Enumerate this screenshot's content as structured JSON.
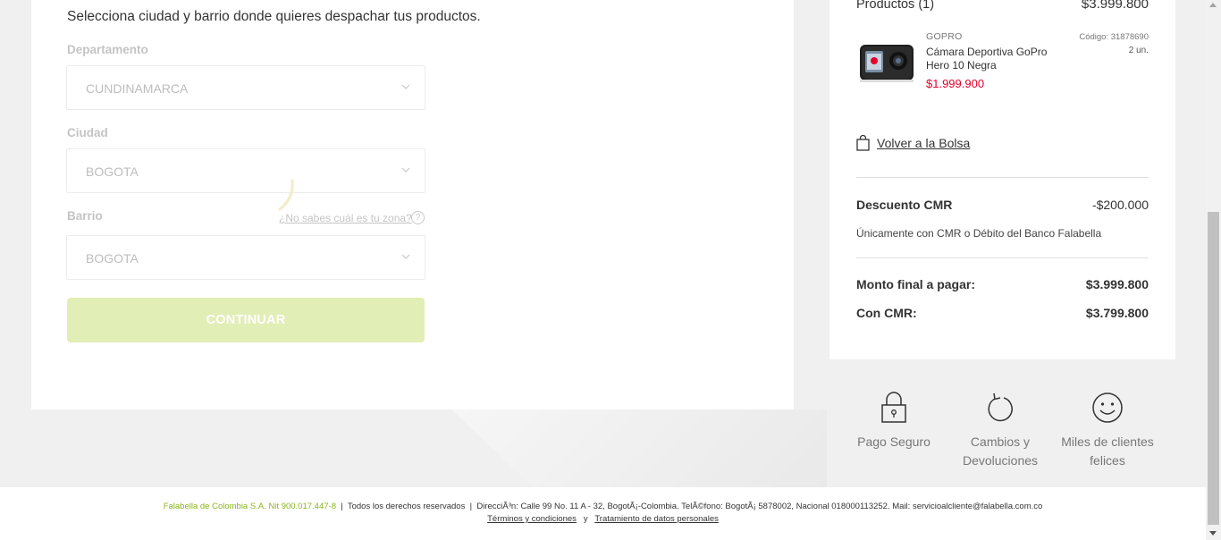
{
  "form": {
    "intro": "Selecciona ciudad y barrio donde quieres despachar tus productos.",
    "department_label": "Departamento",
    "department_value": "CUNDINAMARCA",
    "city_label": "Ciudad",
    "city_value": "BOGOTA",
    "neighborhood_label": "Barrio",
    "neighborhood_value": "BOGOTA",
    "zone_help_link": "¿No sabes cuál es tu zona?",
    "help_glyph": "?",
    "continue_label": "CONTINUAR",
    "continue_color": "#e1eeb6"
  },
  "summary": {
    "products_title": "Productos (1)",
    "products_total": "$3.999.800",
    "product": {
      "brand": "GOPRO",
      "name": "Cámara Deportiva GoPro Hero 10 Negra",
      "price": "$1.999.900",
      "code": "Código: 31878690",
      "quantity": "2 un.",
      "price_color": "#e4002b"
    },
    "back_link": "Volver a la Bolsa",
    "cmr_discount_label": "Descuento CMR",
    "cmr_discount_value": "-$200.000",
    "cmr_note": "Únicamente con CMR o Débito del Banco Falabella",
    "final_label": "Monto final a pagar:",
    "final_value": "$3.999.800",
    "with_cmr_label": "Con CMR:",
    "with_cmr_value": "$3.799.800"
  },
  "benefits": [
    {
      "icon": "padlock-icon",
      "label": "Pago Seguro"
    },
    {
      "icon": "return-arrow-icon",
      "label": "Cambios y Devoluciones"
    },
    {
      "icon": "smiley-icon",
      "label": "Miles de clientes felices"
    }
  ],
  "footer": {
    "company": "Falabella de Colombia S.A. Nit 900.017.447-8",
    "separator": "|",
    "rights": "Todos los derechos reservados",
    "address": "DirecciÃ³n: Calle 99 No. 11 A - 32, BogotÃ¡-Colombia. TelÃ©fono: BogotÃ¡ 5878002, Nacional 018000113252. Mail: servicioalcliente@falabella.com.co",
    "terms": "Términos y condiciones",
    "and": "y",
    "privacy": "Tratamiento de datos personales",
    "brand_green": "#8ab51b"
  }
}
